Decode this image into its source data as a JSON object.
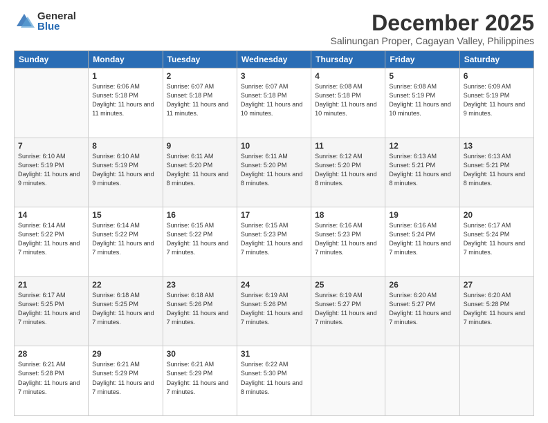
{
  "logo": {
    "general": "General",
    "blue": "Blue"
  },
  "header": {
    "month_year": "December 2025",
    "location": "Salinungan Proper, Cagayan Valley, Philippines"
  },
  "weekdays": [
    "Sunday",
    "Monday",
    "Tuesday",
    "Wednesday",
    "Thursday",
    "Friday",
    "Saturday"
  ],
  "weeks": [
    [
      {
        "day": "",
        "sunrise": "",
        "sunset": "",
        "daylight": ""
      },
      {
        "day": "1",
        "sunrise": "Sunrise: 6:06 AM",
        "sunset": "Sunset: 5:18 PM",
        "daylight": "Daylight: 11 hours and 11 minutes."
      },
      {
        "day": "2",
        "sunrise": "Sunrise: 6:07 AM",
        "sunset": "Sunset: 5:18 PM",
        "daylight": "Daylight: 11 hours and 11 minutes."
      },
      {
        "day": "3",
        "sunrise": "Sunrise: 6:07 AM",
        "sunset": "Sunset: 5:18 PM",
        "daylight": "Daylight: 11 hours and 10 minutes."
      },
      {
        "day": "4",
        "sunrise": "Sunrise: 6:08 AM",
        "sunset": "Sunset: 5:18 PM",
        "daylight": "Daylight: 11 hours and 10 minutes."
      },
      {
        "day": "5",
        "sunrise": "Sunrise: 6:08 AM",
        "sunset": "Sunset: 5:19 PM",
        "daylight": "Daylight: 11 hours and 10 minutes."
      },
      {
        "day": "6",
        "sunrise": "Sunrise: 6:09 AM",
        "sunset": "Sunset: 5:19 PM",
        "daylight": "Daylight: 11 hours and 9 minutes."
      }
    ],
    [
      {
        "day": "7",
        "sunrise": "Sunrise: 6:10 AM",
        "sunset": "Sunset: 5:19 PM",
        "daylight": "Daylight: 11 hours and 9 minutes."
      },
      {
        "day": "8",
        "sunrise": "Sunrise: 6:10 AM",
        "sunset": "Sunset: 5:19 PM",
        "daylight": "Daylight: 11 hours and 9 minutes."
      },
      {
        "day": "9",
        "sunrise": "Sunrise: 6:11 AM",
        "sunset": "Sunset: 5:20 PM",
        "daylight": "Daylight: 11 hours and 8 minutes."
      },
      {
        "day": "10",
        "sunrise": "Sunrise: 6:11 AM",
        "sunset": "Sunset: 5:20 PM",
        "daylight": "Daylight: 11 hours and 8 minutes."
      },
      {
        "day": "11",
        "sunrise": "Sunrise: 6:12 AM",
        "sunset": "Sunset: 5:20 PM",
        "daylight": "Daylight: 11 hours and 8 minutes."
      },
      {
        "day": "12",
        "sunrise": "Sunrise: 6:13 AM",
        "sunset": "Sunset: 5:21 PM",
        "daylight": "Daylight: 11 hours and 8 minutes."
      },
      {
        "day": "13",
        "sunrise": "Sunrise: 6:13 AM",
        "sunset": "Sunset: 5:21 PM",
        "daylight": "Daylight: 11 hours and 8 minutes."
      }
    ],
    [
      {
        "day": "14",
        "sunrise": "Sunrise: 6:14 AM",
        "sunset": "Sunset: 5:22 PM",
        "daylight": "Daylight: 11 hours and 7 minutes."
      },
      {
        "day": "15",
        "sunrise": "Sunrise: 6:14 AM",
        "sunset": "Sunset: 5:22 PM",
        "daylight": "Daylight: 11 hours and 7 minutes."
      },
      {
        "day": "16",
        "sunrise": "Sunrise: 6:15 AM",
        "sunset": "Sunset: 5:22 PM",
        "daylight": "Daylight: 11 hours and 7 minutes."
      },
      {
        "day": "17",
        "sunrise": "Sunrise: 6:15 AM",
        "sunset": "Sunset: 5:23 PM",
        "daylight": "Daylight: 11 hours and 7 minutes."
      },
      {
        "day": "18",
        "sunrise": "Sunrise: 6:16 AM",
        "sunset": "Sunset: 5:23 PM",
        "daylight": "Daylight: 11 hours and 7 minutes."
      },
      {
        "day": "19",
        "sunrise": "Sunrise: 6:16 AM",
        "sunset": "Sunset: 5:24 PM",
        "daylight": "Daylight: 11 hours and 7 minutes."
      },
      {
        "day": "20",
        "sunrise": "Sunrise: 6:17 AM",
        "sunset": "Sunset: 5:24 PM",
        "daylight": "Daylight: 11 hours and 7 minutes."
      }
    ],
    [
      {
        "day": "21",
        "sunrise": "Sunrise: 6:17 AM",
        "sunset": "Sunset: 5:25 PM",
        "daylight": "Daylight: 11 hours and 7 minutes."
      },
      {
        "day": "22",
        "sunrise": "Sunrise: 6:18 AM",
        "sunset": "Sunset: 5:25 PM",
        "daylight": "Daylight: 11 hours and 7 minutes."
      },
      {
        "day": "23",
        "sunrise": "Sunrise: 6:18 AM",
        "sunset": "Sunset: 5:26 PM",
        "daylight": "Daylight: 11 hours and 7 minutes."
      },
      {
        "day": "24",
        "sunrise": "Sunrise: 6:19 AM",
        "sunset": "Sunset: 5:26 PM",
        "daylight": "Daylight: 11 hours and 7 minutes."
      },
      {
        "day": "25",
        "sunrise": "Sunrise: 6:19 AM",
        "sunset": "Sunset: 5:27 PM",
        "daylight": "Daylight: 11 hours and 7 minutes."
      },
      {
        "day": "26",
        "sunrise": "Sunrise: 6:20 AM",
        "sunset": "Sunset: 5:27 PM",
        "daylight": "Daylight: 11 hours and 7 minutes."
      },
      {
        "day": "27",
        "sunrise": "Sunrise: 6:20 AM",
        "sunset": "Sunset: 5:28 PM",
        "daylight": "Daylight: 11 hours and 7 minutes."
      }
    ],
    [
      {
        "day": "28",
        "sunrise": "Sunrise: 6:21 AM",
        "sunset": "Sunset: 5:28 PM",
        "daylight": "Daylight: 11 hours and 7 minutes."
      },
      {
        "day": "29",
        "sunrise": "Sunrise: 6:21 AM",
        "sunset": "Sunset: 5:29 PM",
        "daylight": "Daylight: 11 hours and 7 minutes."
      },
      {
        "day": "30",
        "sunrise": "Sunrise: 6:21 AM",
        "sunset": "Sunset: 5:29 PM",
        "daylight": "Daylight: 11 hours and 7 minutes."
      },
      {
        "day": "31",
        "sunrise": "Sunrise: 6:22 AM",
        "sunset": "Sunset: 5:30 PM",
        "daylight": "Daylight: 11 hours and 8 minutes."
      },
      {
        "day": "",
        "sunrise": "",
        "sunset": "",
        "daylight": ""
      },
      {
        "day": "",
        "sunrise": "",
        "sunset": "",
        "daylight": ""
      },
      {
        "day": "",
        "sunrise": "",
        "sunset": "",
        "daylight": ""
      }
    ]
  ]
}
